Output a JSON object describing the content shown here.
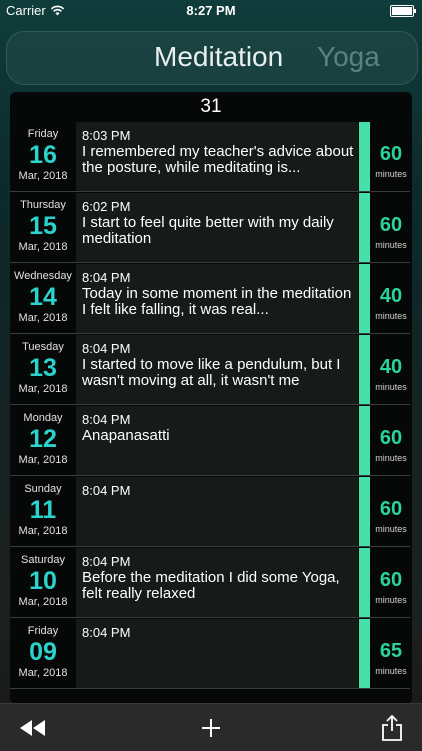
{
  "status_bar": {
    "carrier": "Carrier",
    "time": "8:27 PM"
  },
  "segmented": {
    "active": "Meditation",
    "inactive": "Yoga"
  },
  "list": {
    "count": "31",
    "minutes_label": "minutes",
    "entries": [
      {
        "dow": "Friday",
        "day": "16",
        "month": "Mar, 2018",
        "time": "8:03 PM",
        "text": "I remembered my teacher's advice about the posture, while meditating is...",
        "minutes": "60"
      },
      {
        "dow": "Thursday",
        "day": "15",
        "month": "Mar, 2018",
        "time": "6:02 PM",
        "text": "I start to feel quite better with my daily meditation",
        "minutes": "60"
      },
      {
        "dow": "Wednesday",
        "day": "14",
        "month": "Mar, 2018",
        "time": "8:04 PM",
        "text": "Today in some moment in the meditation I felt like falling, it was real...",
        "minutes": "40"
      },
      {
        "dow": "Tuesday",
        "day": "13",
        "month": "Mar, 2018",
        "time": "8:04 PM",
        "text": "I started to move like a pendulum, but I wasn't moving at all, it wasn't me",
        "minutes": "40"
      },
      {
        "dow": "Monday",
        "day": "12",
        "month": "Mar, 2018",
        "time": "8:04 PM",
        "text": "Anapanasatti",
        "minutes": "60"
      },
      {
        "dow": "Sunday",
        "day": "11",
        "month": "Mar, 2018",
        "time": "8:04 PM",
        "text": "",
        "minutes": "60"
      },
      {
        "dow": "Saturday",
        "day": "10",
        "month": "Mar, 2018",
        "time": "8:04 PM",
        "text": "Before the meditation I did some Yoga, felt really relaxed",
        "minutes": "60"
      },
      {
        "dow": "Friday",
        "day": "09",
        "month": "Mar, 2018",
        "time": "8:04 PM",
        "text": "",
        "minutes": "65"
      }
    ]
  },
  "toolbar": {
    "icons": [
      "rewind-icon",
      "plus-icon",
      "share-icon"
    ]
  },
  "colors": {
    "accent": "#2ad3cb",
    "bar": "#46e0a8",
    "minutes": "#2bd39a"
  }
}
